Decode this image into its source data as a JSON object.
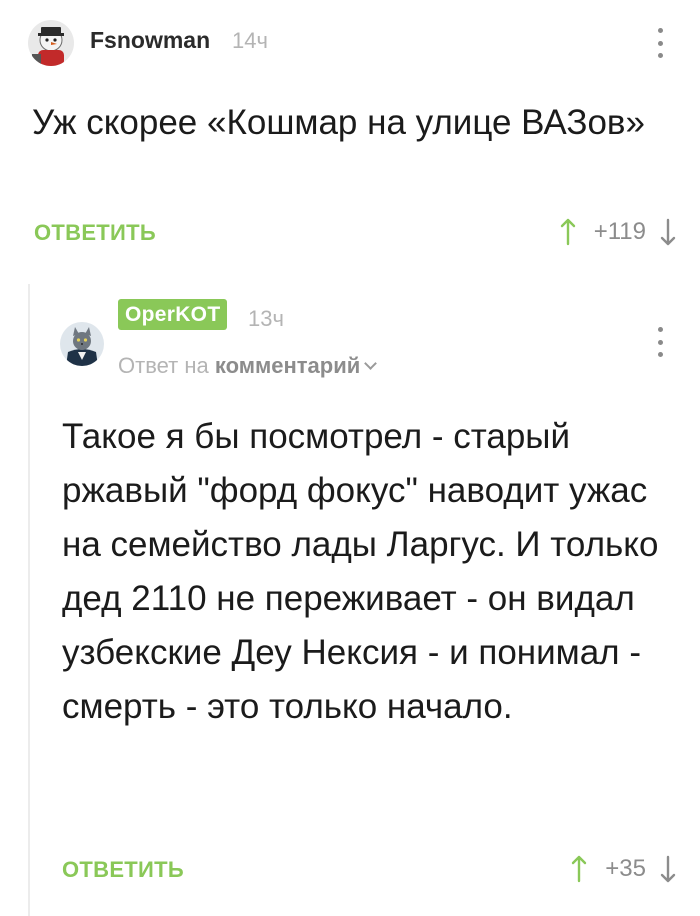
{
  "comments": [
    {
      "author": "Fsnowman",
      "time": "14ч",
      "text": "Уж скорее «Кошмар на улице ВАЗов»",
      "reply_label": "ОТВЕТИТЬ",
      "score": "+119",
      "avatar_icon": "avatar-icon",
      "menu_icon": "more-vertical-icon"
    },
    {
      "author": "OperKOT",
      "time": "13ч",
      "reply_to_prefix": "Ответ на",
      "reply_to_link": "комментарий",
      "text": "Такое я бы посмотрел - старый ржавый \"форд фокус\" наводит ужас на семейство лады Ларгус. И только дед 2110 не переживает - он видал узбекские Деу Нексия - и понимал - смерть - это только начало.",
      "reply_label": "ОТВЕТИТЬ",
      "score": "+35",
      "avatar_icon": "avatar-icon",
      "menu_icon": "more-vertical-icon"
    }
  ],
  "colors": {
    "accent_green": "#8ac858",
    "muted_gray": "#b4b4b4",
    "text": "#1b1b1b",
    "thread_line": "#ececec"
  },
  "icons": {
    "upvote": "arrow-up-icon",
    "downvote": "arrow-down-icon",
    "expand": "chevron-down-icon"
  }
}
